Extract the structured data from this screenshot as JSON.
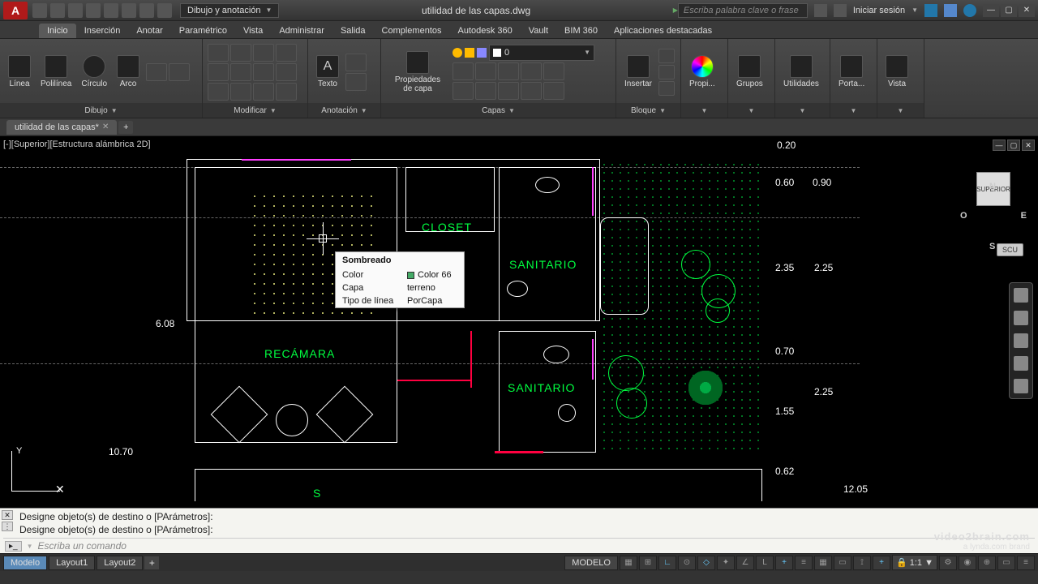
{
  "title": "utilidad de las capas.dwg",
  "workspace": "Dibujo y anotación",
  "search_placeholder": "Escriba palabra clave o frase",
  "signin": "Iniciar sesión",
  "menu": [
    "Inicio",
    "Inserción",
    "Anotar",
    "Paramétrico",
    "Vista",
    "Administrar",
    "Salida",
    "Complementos",
    "Autodesk 360",
    "Vault",
    "BIM 360",
    "Aplicaciones destacadas"
  ],
  "active_menu": "Inicio",
  "ribbon": {
    "dibujo": {
      "title": "Dibujo",
      "items": [
        "Línea",
        "Polilínea",
        "Círculo",
        "Arco"
      ]
    },
    "modificar": {
      "title": "Modificar"
    },
    "anotacion": {
      "title": "Anotación",
      "text": "Texto"
    },
    "capas": {
      "title": "Capas",
      "props": "Propiedades de capa",
      "current": "0"
    },
    "bloque": {
      "title": "Bloque",
      "insertar": "Insertar"
    },
    "propiedades": {
      "title": "",
      "btn": "Propi..."
    },
    "grupos": {
      "title": "",
      "btn": "Grupos"
    },
    "utilidades": {
      "title": "",
      "btn": "Utilidades"
    },
    "porta": {
      "title": "",
      "btn": "Porta..."
    },
    "vista": {
      "title": "",
      "btn": "Vista"
    }
  },
  "filetab": "utilidad de las capas*",
  "viewport_label": "[-][Superior][Estructura alámbrica 2D]",
  "rooms": {
    "closet": "CLOSET",
    "sanitario1": "SANITARIO",
    "sanitario2": "SANITARIO",
    "recamara": "RECÁMARA",
    "s": "S"
  },
  "dims": {
    "d1": "0.20",
    "d2": "0.60",
    "d3": "0.90",
    "d4": "2.35",
    "d5": "2.25",
    "d6": "0.70",
    "d7": "2.25",
    "d8": "1.55",
    "d9": "0.62",
    "d10": "12.05",
    "d11": "10.70",
    "d12": "6.08"
  },
  "tooltip": {
    "title": "Sombreado",
    "rows": {
      "color_k": "Color",
      "color_v": "Color 66",
      "capa_k": "Capa",
      "capa_v": "terreno",
      "tipo_k": "Tipo de línea",
      "tipo_v": "PorCapa"
    }
  },
  "viewcube": {
    "n": "N",
    "s": "S",
    "e": "E",
    "o": "O",
    "face": "SUPERIOR",
    "scu": "SCU"
  },
  "ucs": {
    "y": "Y",
    "x": "✕"
  },
  "cmd": {
    "hist": "Designe objeto(s) de destino o [PArámetros]:",
    "placeholder": "Escriba un comando"
  },
  "status": {
    "modelo": "Modelo",
    "l1": "Layout1",
    "l2": "Layout2",
    "model_btn": "MODELO",
    "grid": "▦",
    "scale": "1:1"
  },
  "watermark": {
    "l1": "video2brain.com",
    "l2": "a lynda.com brand"
  }
}
